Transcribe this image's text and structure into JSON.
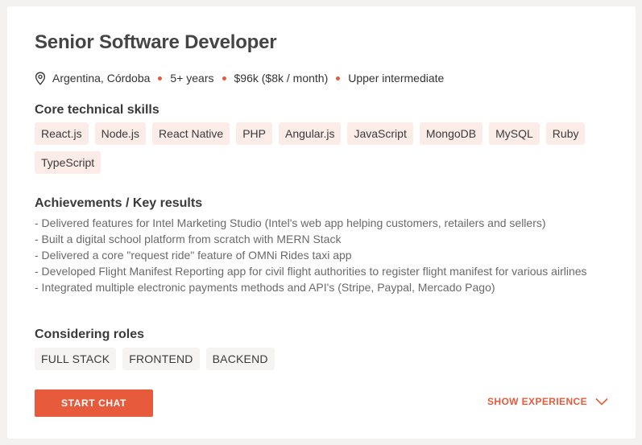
{
  "card": {
    "title": "Senior Software Developer",
    "meta": {
      "location": "Argentina, Córdoba",
      "experience": "5+ years",
      "salary": "$96k ($8k / month)",
      "english": "Upper intermediate"
    }
  },
  "skills": {
    "heading": "Core technical skills",
    "items": [
      "React.js",
      "Node.js",
      "React Native",
      "PHP",
      "Angular.js",
      "JavaScript",
      "MongoDB",
      "MySQL",
      "Ruby",
      "TypeScript"
    ]
  },
  "achievements": {
    "heading": "Achievements / Key results",
    "lines": [
      "- Delivered features for Intel Marketing Studio (Intel's web app helping customers, retailers and sellers)",
      "- Built a digital school platform from scratch with MERN Stack",
      "- Delivered a core \"request ride\" feature of OMNi Rides taxi app",
      "- Developed Flight Manifest Reporting app for civil flight authorities to register flight manifest for various airlines",
      "- Integrated multiple electronic payments methods and API's (Stripe, Paypal, Mercado Pago)"
    ]
  },
  "roles": {
    "heading": "Considering roles",
    "items": [
      "FULL STACK",
      "FRONTEND",
      "BACKEND"
    ]
  },
  "actions": {
    "start_chat": "START CHAT",
    "show_experience": "SHOW EXPERIENCE"
  },
  "icons": {
    "location": "map-pin-icon",
    "expand": "chevron-down-icon"
  },
  "colors": {
    "accent": "#e85a3c",
    "skill_chip_bg": "#fbece8",
    "role_chip_bg": "#f5f4f2"
  }
}
